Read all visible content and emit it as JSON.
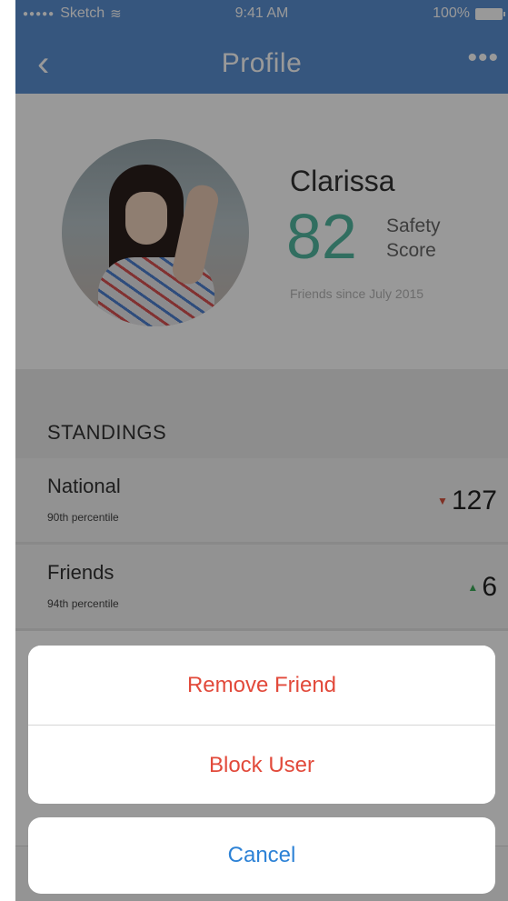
{
  "status_bar": {
    "carrier": "Sketch",
    "signal_dots": "●●●●●",
    "time": "9:41 AM",
    "battery": "100%"
  },
  "nav": {
    "back_icon": "‹",
    "title": "Profile",
    "more_icon": "•••"
  },
  "profile": {
    "name": "Clarissa",
    "safety_score": "82",
    "safety_label_line1": "Safety",
    "safety_label_line2": "Score",
    "friends_since": "Friends since July 2015"
  },
  "standings": {
    "title": "STANDINGS",
    "rows": [
      {
        "label": "National",
        "percentile": "90th percentile",
        "value": "127",
        "trend": "down",
        "trend_icon": "▼"
      },
      {
        "label": "Friends",
        "percentile": "94th percentile",
        "value": "6",
        "trend": "up",
        "trend_icon": "▲"
      }
    ]
  },
  "action_sheet": {
    "remove_friend": "Remove Friend",
    "block_user": "Block User",
    "cancel": "Cancel"
  },
  "colors": {
    "header": "#5b8fd3",
    "score": "#53b8a0",
    "destructive": "#e24a3b",
    "cancel": "#2d82d6",
    "trend_down": "#d4503c",
    "trend_up": "#3faa5a"
  }
}
